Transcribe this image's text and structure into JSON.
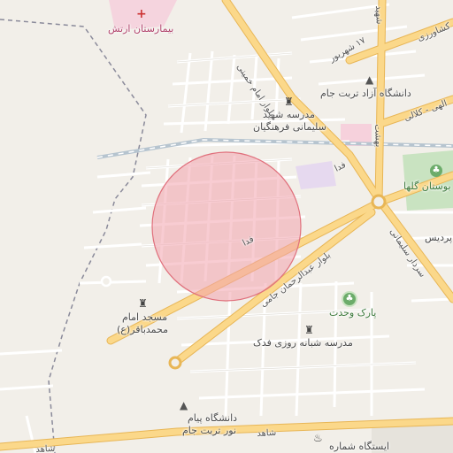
{
  "map": {
    "highlight_circle": {
      "fill": "#f3a3ad",
      "stroke": "#e0707c"
    },
    "colors": {
      "background": "#f2efe9",
      "major_road": "#fbd88a",
      "major_road_edge": "#e8b656",
      "minor_road": "#ffffff",
      "minor_edge": "#dddad3",
      "rail": "#b6c4cf",
      "park": "#c9e3c1",
      "hospital": "#f6c9d8",
      "campus": "#e6d9ef",
      "boundary": "#8a8a9a"
    }
  },
  "labels": {
    "hospital": "بیمارستان ارتش",
    "university_azad": "دانشگاه آزاد تربت جام",
    "school_shahid_1": "مدرسه شهید",
    "school_shahid_2": "سلیمانی فرهنگیان",
    "mosque_1": "مسجد امام",
    "mosque_2": "محمدباقر(ع)",
    "park_vahdat": "پارک وحدت",
    "school_ghadak": "مدرسه شبانه روزی فدک",
    "payam_1": "دانشگاه پیام",
    "payam_2": "نور تربت جام",
    "station": "ایستگاه شماره",
    "golha": "بوستان گلها",
    "poris": "پردیس",
    "road_khomeini": "بلوار امام خمینی",
    "road_shahrivar": "۱۷ شهریور",
    "road_abdolrahman": "بلوار عبدالرحمان جامی",
    "road_fada_1": "فدا",
    "road_fada_2": "فدا",
    "road_soleimani": "سردار سلیمانی",
    "road_kalali": "الهی - کلالی",
    "road_shahed_1": "شاهد",
    "road_shahed_2": "شاهد",
    "road_moshtagh": "بهشت",
    "road_shahid": "شهید",
    "road_top_right": "کشاورزی"
  },
  "icons": {
    "hospital": "+",
    "school": "▲",
    "mosque": "♜",
    "park": "♣",
    "fire": "♨"
  }
}
